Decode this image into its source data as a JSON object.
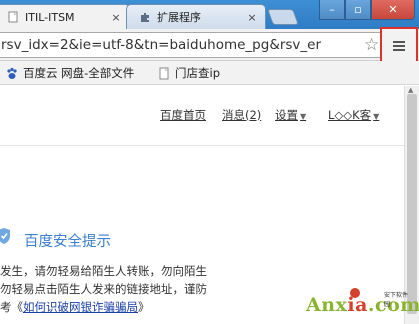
{
  "browser": {
    "tabs": [
      {
        "title": "ITIL-ITSM",
        "close": "×"
      },
      {
        "title": "扩展程序",
        "close": "×"
      }
    ],
    "window_controls": {
      "minimize": "–",
      "maximize": "▫",
      "close": "✕"
    },
    "address": "rsv_idx=2&ie=utf-8&tn=baiduhome_pg&rsv_er",
    "star_glyph": "☆"
  },
  "bookmarks": [
    {
      "label": "百度云 网盘-全部文件"
    },
    {
      "label": "门店查ip"
    }
  ],
  "page": {
    "nav": {
      "home": "百度首页",
      "messages": "消息(2)",
      "settings": "设置",
      "user": "L◇◇K客"
    },
    "safety": {
      "title": "百度安全提示"
    },
    "body_lines": {
      "line1": "发生，请勿轻易给陌生人转账，勿向陌生",
      "line2": "勿轻易点击陌生人发来的链接地址，谨防",
      "line3_prefix": "考《",
      "line3_link": "如何识破网银诈骗骗局",
      "line3_suffix": "》"
    }
  },
  "watermark": {
    "brand_green": "Anx",
    "brand_red": "ia",
    "brand_tail": ".com",
    "tagline": "安下软件园"
  },
  "colors": {
    "accent": "#3b7fd0",
    "highlight_border": "#e0302a",
    "link": "#1a3fa8"
  }
}
